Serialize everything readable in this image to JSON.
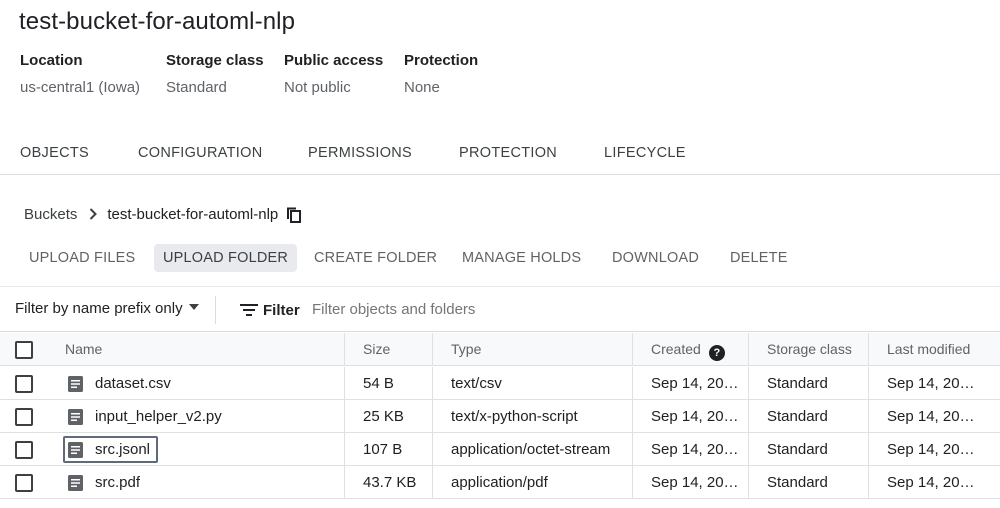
{
  "bucket": {
    "name": "test-bucket-for-automl-nlp",
    "properties": [
      {
        "label": "Location",
        "value": "us-central1 (Iowa)"
      },
      {
        "label": "Storage class",
        "value": "Standard"
      },
      {
        "label": "Public access",
        "value": "Not public"
      },
      {
        "label": "Protection",
        "value": "None"
      }
    ]
  },
  "tabs": [
    {
      "label": "OBJECTS",
      "active": true
    },
    {
      "label": "CONFIGURATION"
    },
    {
      "label": "PERMISSIONS"
    },
    {
      "label": "PROTECTION"
    },
    {
      "label": "LIFECYCLE"
    }
  ],
  "breadcrumb": {
    "root": "Buckets",
    "current": "test-bucket-for-automl-nlp"
  },
  "actions": [
    {
      "label": "UPLOAD FILES"
    },
    {
      "label": "UPLOAD FOLDER",
      "hover": true
    },
    {
      "label": "CREATE FOLDER"
    },
    {
      "label": "MANAGE HOLDS"
    },
    {
      "label": "DOWNLOAD"
    },
    {
      "label": "DELETE"
    }
  ],
  "filter": {
    "mode": "Filter by name prefix only",
    "label": "Filter",
    "placeholder": "Filter objects and folders"
  },
  "table": {
    "columns": [
      "Name",
      "Size",
      "Type",
      "Created",
      "Storage class",
      "Last modified"
    ],
    "help_glyph": "?",
    "rows": [
      {
        "name": "dataset.csv",
        "size": "54 B",
        "type": "text/csv",
        "created": "Sep 14, 20…",
        "storage": "Standard",
        "modified": "Sep 14, 20…"
      },
      {
        "name": "input_helper_v2.py",
        "size": "25 KB",
        "type": "text/x-python-script",
        "created": "Sep 14, 20…",
        "storage": "Standard",
        "modified": "Sep 14, 20…"
      },
      {
        "name": "src.jsonl",
        "size": "107 B",
        "type": "application/octet-stream",
        "created": "Sep 14, 20…",
        "storage": "Standard",
        "modified": "Sep 14, 20…",
        "focused": true
      },
      {
        "name": "src.pdf",
        "size": "43.7 KB",
        "type": "application/pdf",
        "created": "Sep 14, 20…",
        "storage": "Standard",
        "modified": "Sep 14, 20…"
      }
    ]
  },
  "colors": {
    "text": "#202124",
    "muted": "#5f6368",
    "header_bg": "#f8f9fa",
    "hover_bg": "#e8eaed",
    "focus_outline": "#5f6b7a"
  },
  "icons": {
    "breadcrumb_separator": "chevron-right-icon",
    "copy": "copy-icon",
    "filter": "filter-lines-icon",
    "file": "document-icon",
    "help": "help-circle-icon",
    "dropdown": "caret-down-icon"
  }
}
